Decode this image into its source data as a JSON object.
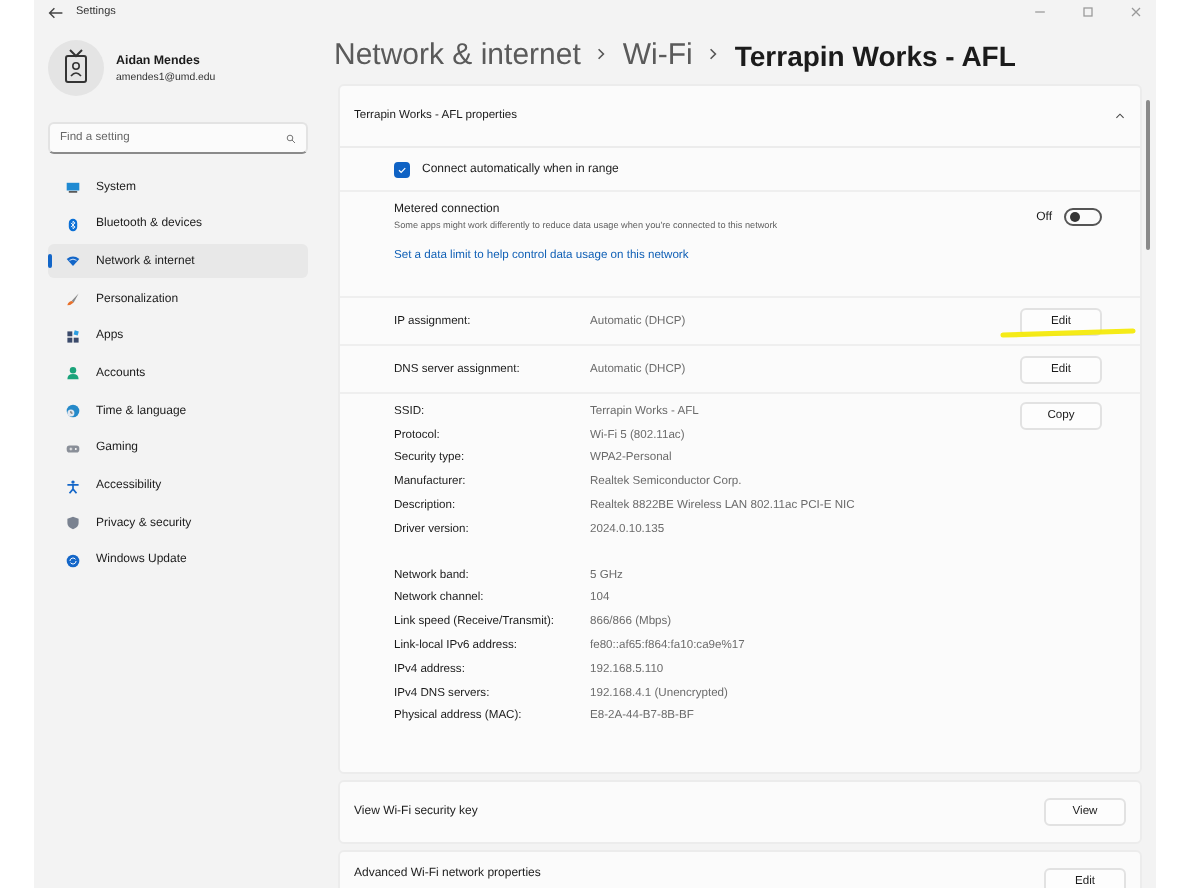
{
  "window": {
    "title": "Settings"
  },
  "profile": {
    "name": "Aidan Mendes",
    "email": "amendes1@umd.edu"
  },
  "search": {
    "placeholder": "Find a setting"
  },
  "nav": [
    {
      "label": "System",
      "selected": false
    },
    {
      "label": "Bluetooth & devices",
      "selected": false
    },
    {
      "label": "Network & internet",
      "selected": true
    },
    {
      "label": "Personalization",
      "selected": false
    },
    {
      "label": "Apps",
      "selected": false
    },
    {
      "label": "Accounts",
      "selected": false
    },
    {
      "label": "Time & language",
      "selected": false
    },
    {
      "label": "Gaming",
      "selected": false
    },
    {
      "label": "Accessibility",
      "selected": false
    },
    {
      "label": "Privacy & security",
      "selected": false
    },
    {
      "label": "Windows Update",
      "selected": false
    }
  ],
  "breadcrumb": [
    "Network & internet",
    "Wi-Fi",
    "Terrapin Works - AFL"
  ],
  "properties": {
    "title": "Terrapin Works - AFL properties",
    "expanded": true,
    "auto_connect": {
      "label": "Connect automatically when in range",
      "checked": true
    },
    "metered": {
      "title": "Metered connection",
      "description": "Some apps might work differently to reduce data usage when you're connected to this network",
      "state_label": "Off",
      "on": false
    },
    "data_limit_link": "Set a data limit to help control data usage on this network",
    "assignments": [
      {
        "label": "IP assignment:",
        "value": "Automatic (DHCP)",
        "button": "Edit"
      },
      {
        "label": "DNS server assignment:",
        "value": "Automatic (DHCP)",
        "button": "Edit"
      }
    ],
    "copy_button": "Copy",
    "details": [
      {
        "label": "SSID:",
        "value": "Terrapin Works - AFL"
      },
      {
        "label": "Protocol:",
        "value": "Wi-Fi 5 (802.11ac)"
      },
      {
        "label": "Security type:",
        "value": "WPA2-Personal"
      },
      {
        "label": "Manufacturer:",
        "value": "Realtek Semiconductor Corp."
      },
      {
        "label": "Description:",
        "value": "Realtek 8822BE Wireless LAN 802.11ac PCI-E NIC"
      },
      {
        "label": "Driver version:",
        "value": "2024.0.10.135"
      }
    ],
    "details_2": [
      {
        "label": "Network band:",
        "value": "5 GHz"
      },
      {
        "label": "Network channel:",
        "value": "104"
      },
      {
        "label": "Link speed (Receive/Transmit):",
        "value": "866/866 (Mbps)"
      },
      {
        "label": "Link-local IPv6 address:",
        "value": "fe80::af65:f864:fa10:ca9e%17"
      },
      {
        "label": "IPv4 address:",
        "value": "192.168.5.110"
      },
      {
        "label": "IPv4 DNS servers:",
        "value": "192.168.4.1 (Unencrypted)"
      },
      {
        "label": "Physical address (MAC):",
        "value": "E8-2A-44-B7-8B-BF"
      }
    ]
  },
  "security_key": {
    "label": "View Wi-Fi security key",
    "button": "View"
  },
  "advanced": {
    "label": "Advanced Wi-Fi network properties",
    "button": "Edit"
  }
}
